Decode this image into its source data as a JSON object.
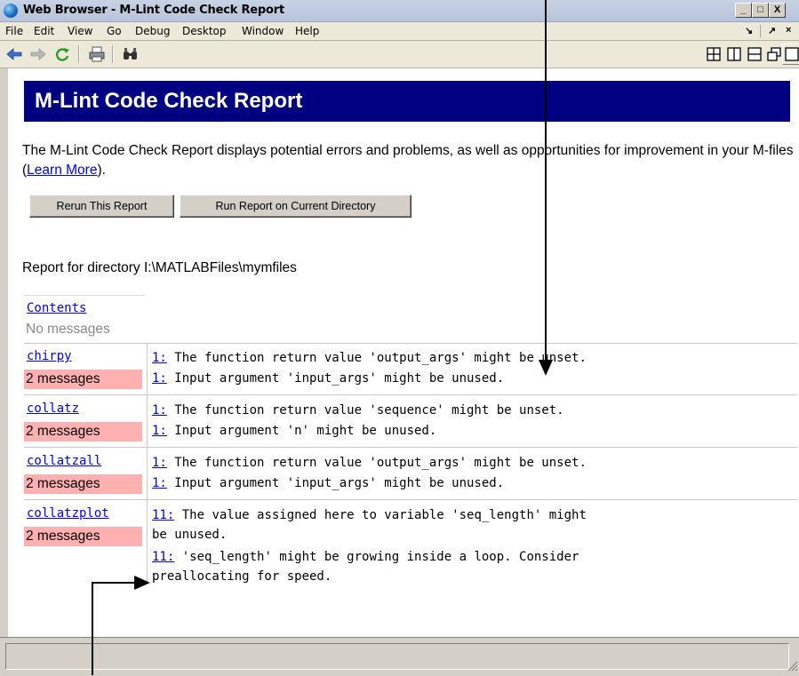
{
  "window": {
    "title": "Web Browser - M-Lint Code Check Report",
    "controls": [
      "_",
      "□",
      "X"
    ]
  },
  "menu": {
    "items": [
      "File",
      "Edit",
      "View",
      "Go",
      "Debug",
      "Desktop",
      "Window",
      "Help"
    ],
    "right": [
      "↘",
      "↗",
      "×"
    ]
  },
  "toolbar": {
    "icons": [
      "back-icon",
      "forward-icon",
      "refresh-icon",
      "print-icon",
      "find-icon"
    ],
    "layout_icons": [
      "tile-grid-icon",
      "tile-columns-icon",
      "tile-rows-icon",
      "float-icon",
      "maximize-icon"
    ]
  },
  "report": {
    "banner": "M-Lint Code Check Report",
    "desc_before": "The M-Lint Code Check Report displays potential errors and problems, as well as opportunities for improvement in your M-files (",
    "learn_more": "Learn More",
    "desc_after": ").",
    "buttons": {
      "rerun": "Rerun This Report",
      "run_current": "Run Report on Current Directory"
    },
    "directory": "Report for directory I:\\MATLABFiles\\mymfiles",
    "contents_label": "Contents",
    "no_messages": "No messages",
    "files": [
      {
        "name": "chirpy",
        "count": "2 messages",
        "messages": [
          {
            "line": "1:",
            "text": " The function return value 'output_args' might be unset."
          },
          {
            "line": "1:",
            "text": " Input argument 'input_args' might be unused."
          }
        ]
      },
      {
        "name": "collatz",
        "count": "2 messages",
        "messages": [
          {
            "line": "1:",
            "text": " The function return value 'sequence' might be unset."
          },
          {
            "line": "1:",
            "text": " Input argument 'n' might be unused."
          }
        ]
      },
      {
        "name": "collatzall",
        "count": "2 messages",
        "messages": [
          {
            "line": "1:",
            "text": " The function return value 'output_args' might be unset."
          },
          {
            "line": "1:",
            "text": " Input argument 'input_args' might be unused."
          }
        ]
      },
      {
        "name": "collatzplot",
        "count": "2 messages",
        "messages": [
          {
            "line": "11:",
            "text": " The value assigned here to variable 'seq_length' might\nbe unused."
          },
          {
            "line": "11:",
            "text": " 'seq_length' might be growing inside a loop. Consider\npreallocating for speed."
          }
        ]
      }
    ]
  },
  "colors": {
    "banner": "#000080",
    "badge": "#ffb0b0",
    "link": "#0000ee"
  }
}
